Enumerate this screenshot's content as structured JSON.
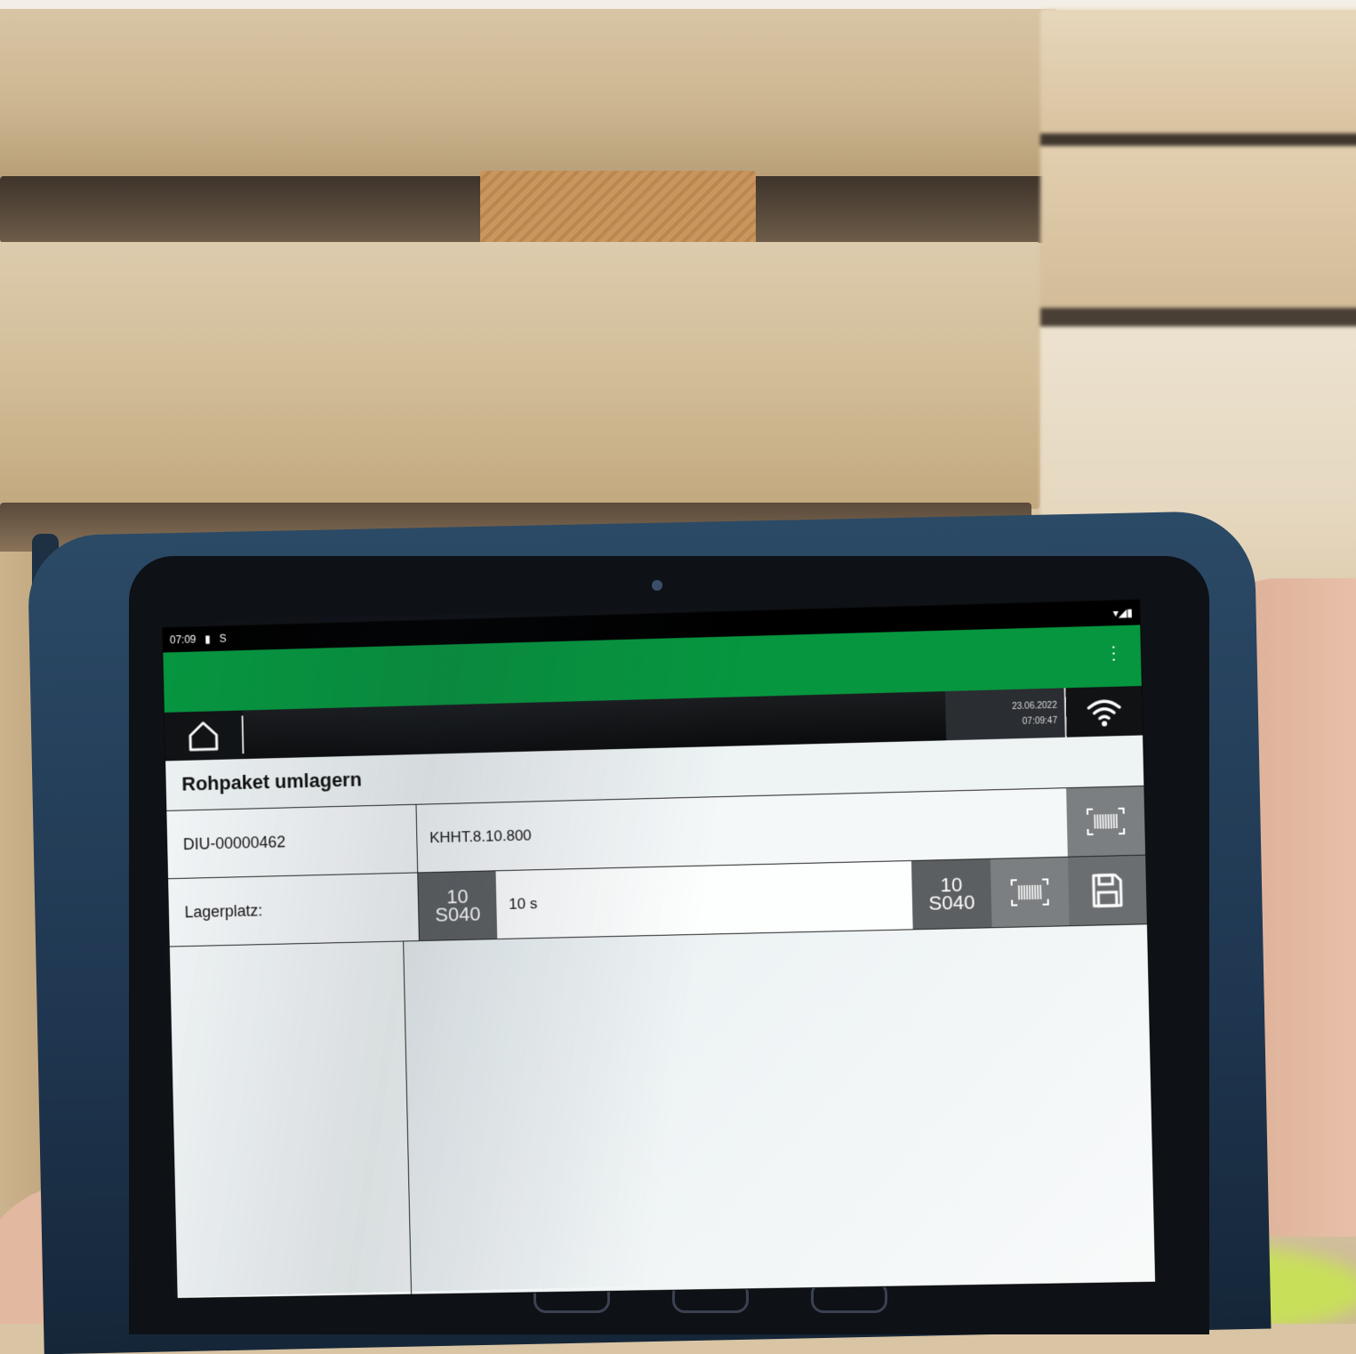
{
  "status_bar": {
    "time": "07:09",
    "extra_icon": "S"
  },
  "header": {
    "date": "23.06.2022",
    "time": "07:09:47"
  },
  "page": {
    "title": "Rohpaket umlagern"
  },
  "package": {
    "id": "DIU-00000462",
    "article": "KHHT.8.10.800"
  },
  "location": {
    "label": "Lagerplatz:",
    "code_line1": "10",
    "code_line2": "S040",
    "input_value": "10 s",
    "suggest_line1": "10",
    "suggest_line2": "S040"
  },
  "icons": {
    "home": "home-icon",
    "wifi": "wifi-icon",
    "barcode": "barcode-scan-icon",
    "save": "save-icon",
    "menu": "overflow-menu-icon"
  },
  "colors": {
    "app_bar": "#06963f",
    "toolbar": "#101214",
    "button_gray": "#6b6e70"
  }
}
